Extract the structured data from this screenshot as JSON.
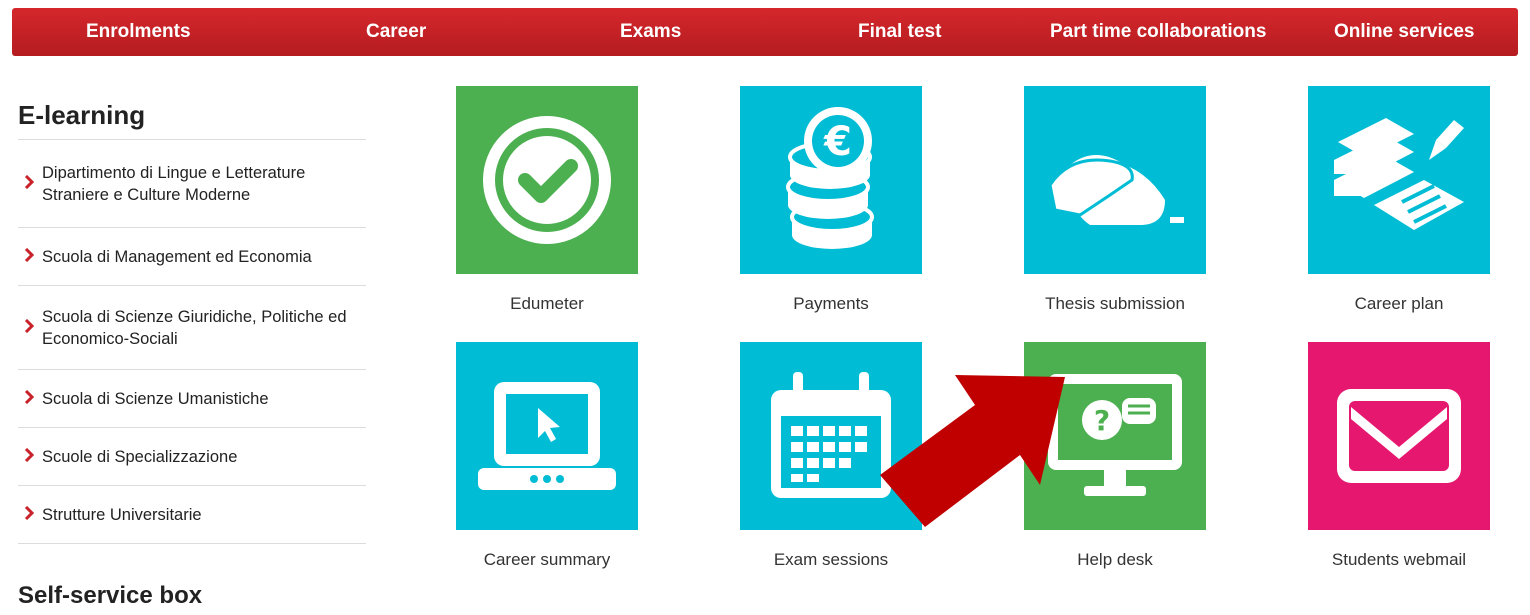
{
  "nav": {
    "items": [
      {
        "label": "Enrolments"
      },
      {
        "label": "Career"
      },
      {
        "label": "Exams"
      },
      {
        "label": "Final test"
      },
      {
        "label": "Part time collaborations"
      },
      {
        "label": "Online services"
      }
    ]
  },
  "sidebar": {
    "title": "E-learning",
    "items": [
      {
        "label": "Dipartimento di Lingue e Letterature Straniere e Culture Moderne"
      },
      {
        "label": "Scuola di Management ed Economia"
      },
      {
        "label": "Scuola di Scienze Giuridiche, Politiche ed Economico-Sociali"
      },
      {
        "label": "Scuola di Scienze Umanistiche"
      },
      {
        "label": "Scuole di Specializzazione"
      },
      {
        "label": "Strutture Universitarie"
      }
    ],
    "section2_title": "Self-service box"
  },
  "tiles": [
    {
      "label": "Edumeter",
      "icon": "check-circle-icon",
      "color": "#4caf50"
    },
    {
      "label": "Payments",
      "icon": "euro-coins-icon",
      "color": "#00bcd4"
    },
    {
      "label": "Thesis submission",
      "icon": "hand-mouse-icon",
      "color": "#00bcd4"
    },
    {
      "label": "Career plan",
      "icon": "books-pen-icon",
      "color": "#00bcd4"
    },
    {
      "label": "Career summary",
      "icon": "laptop-cursor-icon",
      "color": "#00bcd4"
    },
    {
      "label": "Exam sessions",
      "icon": "calendar-icon",
      "color": "#00bcd4"
    },
    {
      "label": "Help desk",
      "icon": "monitor-question-icon",
      "color": "#4caf50"
    },
    {
      "label": "Students webmail",
      "icon": "envelope-icon",
      "color": "#e6176e"
    }
  ],
  "colors": {
    "nav_red": "#c8232a",
    "chevron_red": "#c8232a",
    "arrow_red": "#c00000",
    "green": "#4caf50",
    "cyan": "#00bcd4",
    "pink": "#e6176e"
  }
}
